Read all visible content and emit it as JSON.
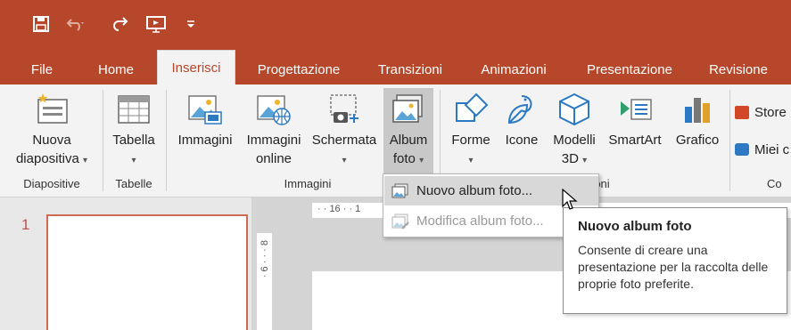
{
  "quick_access": {
    "icons": [
      "save-icon",
      "undo-icon",
      "redo-icon",
      "start-from-beginning-icon",
      "customize-quick-access-icon"
    ]
  },
  "tabs": [
    {
      "label": "File",
      "active": false
    },
    {
      "label": "Home",
      "active": false
    },
    {
      "label": "Inserisci",
      "active": true
    },
    {
      "label": "Progettazione",
      "active": false
    },
    {
      "label": "Transizioni",
      "active": false
    },
    {
      "label": "Animazioni",
      "active": false
    },
    {
      "label": "Presentazione",
      "active": false
    },
    {
      "label": "Revisione",
      "active": false
    }
  ],
  "ribbon": {
    "nuova_diapositiva": {
      "line1": "Nuova",
      "line2": "diapositiva"
    },
    "tabella": {
      "label": "Tabella"
    },
    "immagini": {
      "label": "Immagini"
    },
    "immagini_online": {
      "line1": "Immagini",
      "line2": "online"
    },
    "schermata": {
      "label": "Schermata"
    },
    "album": {
      "line1": "Album",
      "line2": "foto"
    },
    "forme": {
      "label": "Forme"
    },
    "icone": {
      "label": "Icone"
    },
    "modelli3d": {
      "line1": "Modelli",
      "line2": "3D"
    },
    "smartart": {
      "label": "SmartArt"
    },
    "grafico": {
      "label": "Grafico"
    },
    "store": {
      "label": "Store"
    },
    "miei": {
      "label": "Miei c"
    },
    "groups": {
      "diapositive": "Diapositive",
      "tabelle": "Tabelle",
      "immagini": "Immagini",
      "illustrazioni_tail": "oni",
      "co": "Co"
    }
  },
  "dropdown": {
    "items": [
      {
        "label": "Nuovo album foto...",
        "enabled": true
      },
      {
        "label": "Modifica album foto...",
        "enabled": false
      }
    ]
  },
  "tooltip": {
    "title": "Nuovo album foto",
    "body": "Consente di creare una presentazione per la raccolta delle proprie foto preferite."
  },
  "slides": {
    "first_number": "1"
  },
  "ruler": {
    "h_marks": "· · 16 · · 1",
    "v_marks": "· 6 · · · 8"
  },
  "colors": {
    "accent": "#b7472a",
    "ribbon_bg": "#f3f3f3"
  }
}
